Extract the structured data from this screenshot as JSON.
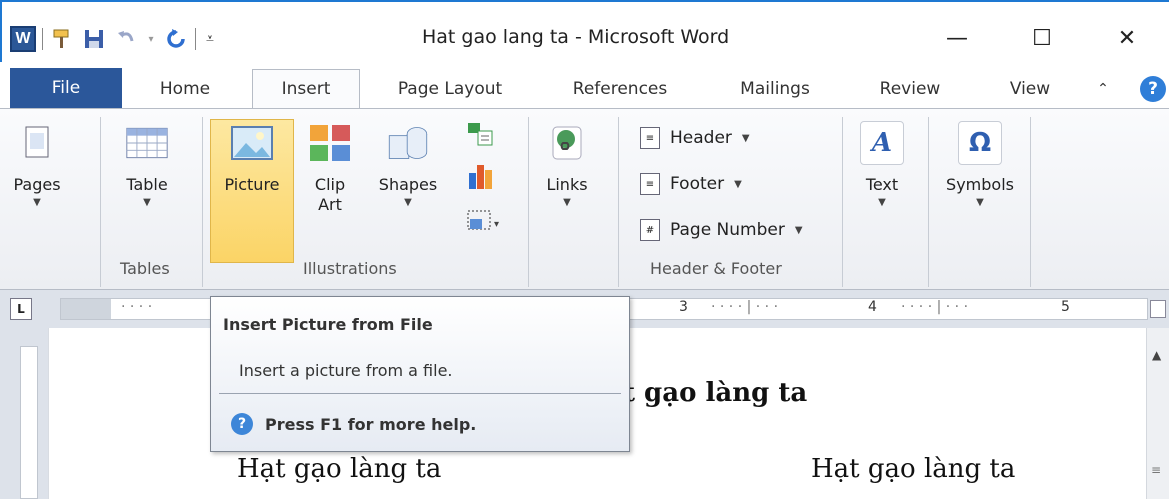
{
  "window": {
    "title": "Hat gao lang ta  -  Microsoft Word",
    "app_icon": "W",
    "minimize": "—",
    "maximize": "☐",
    "close": "✕"
  },
  "quick_access": [
    "format-painter-icon",
    "save-icon",
    "undo-icon",
    "redo-icon",
    "customize-icon"
  ],
  "tabs": [
    {
      "label": "File"
    },
    {
      "label": "Home"
    },
    {
      "label": "Insert"
    },
    {
      "label": "Page Layout"
    },
    {
      "label": "References"
    },
    {
      "label": "Mailings"
    },
    {
      "label": "Review"
    },
    {
      "label": "View"
    }
  ],
  "ribbon": {
    "pages": "Pages",
    "table": "Table",
    "tables_group": "Tables",
    "picture": "Picture",
    "clip_art": "Clip Art",
    "shapes": "Shapes",
    "illustrations_group": "Illustrations",
    "links": "Links",
    "header": "Header",
    "footer": "Footer",
    "page_number": "Page Number",
    "header_footer_group": "Header & Footer",
    "text": "Text",
    "symbols": "Symbols",
    "symbols_glyph": "Ω"
  },
  "ruler": {
    "numbers": [
      "3",
      "4",
      "5"
    ]
  },
  "tooltip": {
    "title": "Insert Picture from File",
    "description": "Insert a picture from a file.",
    "help": "Press F1 for more help."
  },
  "document": {
    "title_fragment": "t gạo làng ta",
    "left_line": "Hạt gạo làng ta",
    "right_line": "Hạt gạo làng ta"
  },
  "colors": {
    "file_tab": "#2b579a",
    "picture_highlight": "#fbd466",
    "help_blue": "#2f7ed8"
  }
}
